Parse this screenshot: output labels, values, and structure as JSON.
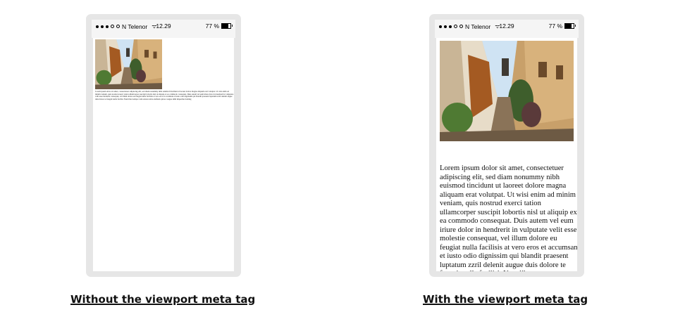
{
  "status_bar": {
    "carrier": "N Telenor",
    "time": "12.29",
    "battery_percent": "77 %",
    "battery_level": 0.77
  },
  "left_phone": {
    "caption": "Without the viewport meta tag",
    "image_icon": "street-photo"
  },
  "right_phone": {
    "caption": "With the viewport meta tag",
    "image_icon": "street-photo"
  },
  "body_text": "Lorem ipsum dolor sit amet, consectetuer adipiscing elit, sed diam nonummy nibh euismod tincidunt ut laoreet dolore magna aliquam erat volutpat. Ut wisi enim ad minim veniam, quis nostrud exerci tation ullamcorper suscipit lobortis nisl ut aliquip ex ea commodo consequat. Duis autem vel eum iriure dolor in hendrerit in vulputate velit esse molestie consequat, vel illum dolore eu feugiat nulla facilisis at vero eros et accumsan et iusto odio dignissim qui blandit praesent luptatum zzril delenit augue duis dolore te feugait nulla facilisi. Nam liber tempor cum soluta nobis eleifend option congue nihil imperdiet doming"
}
